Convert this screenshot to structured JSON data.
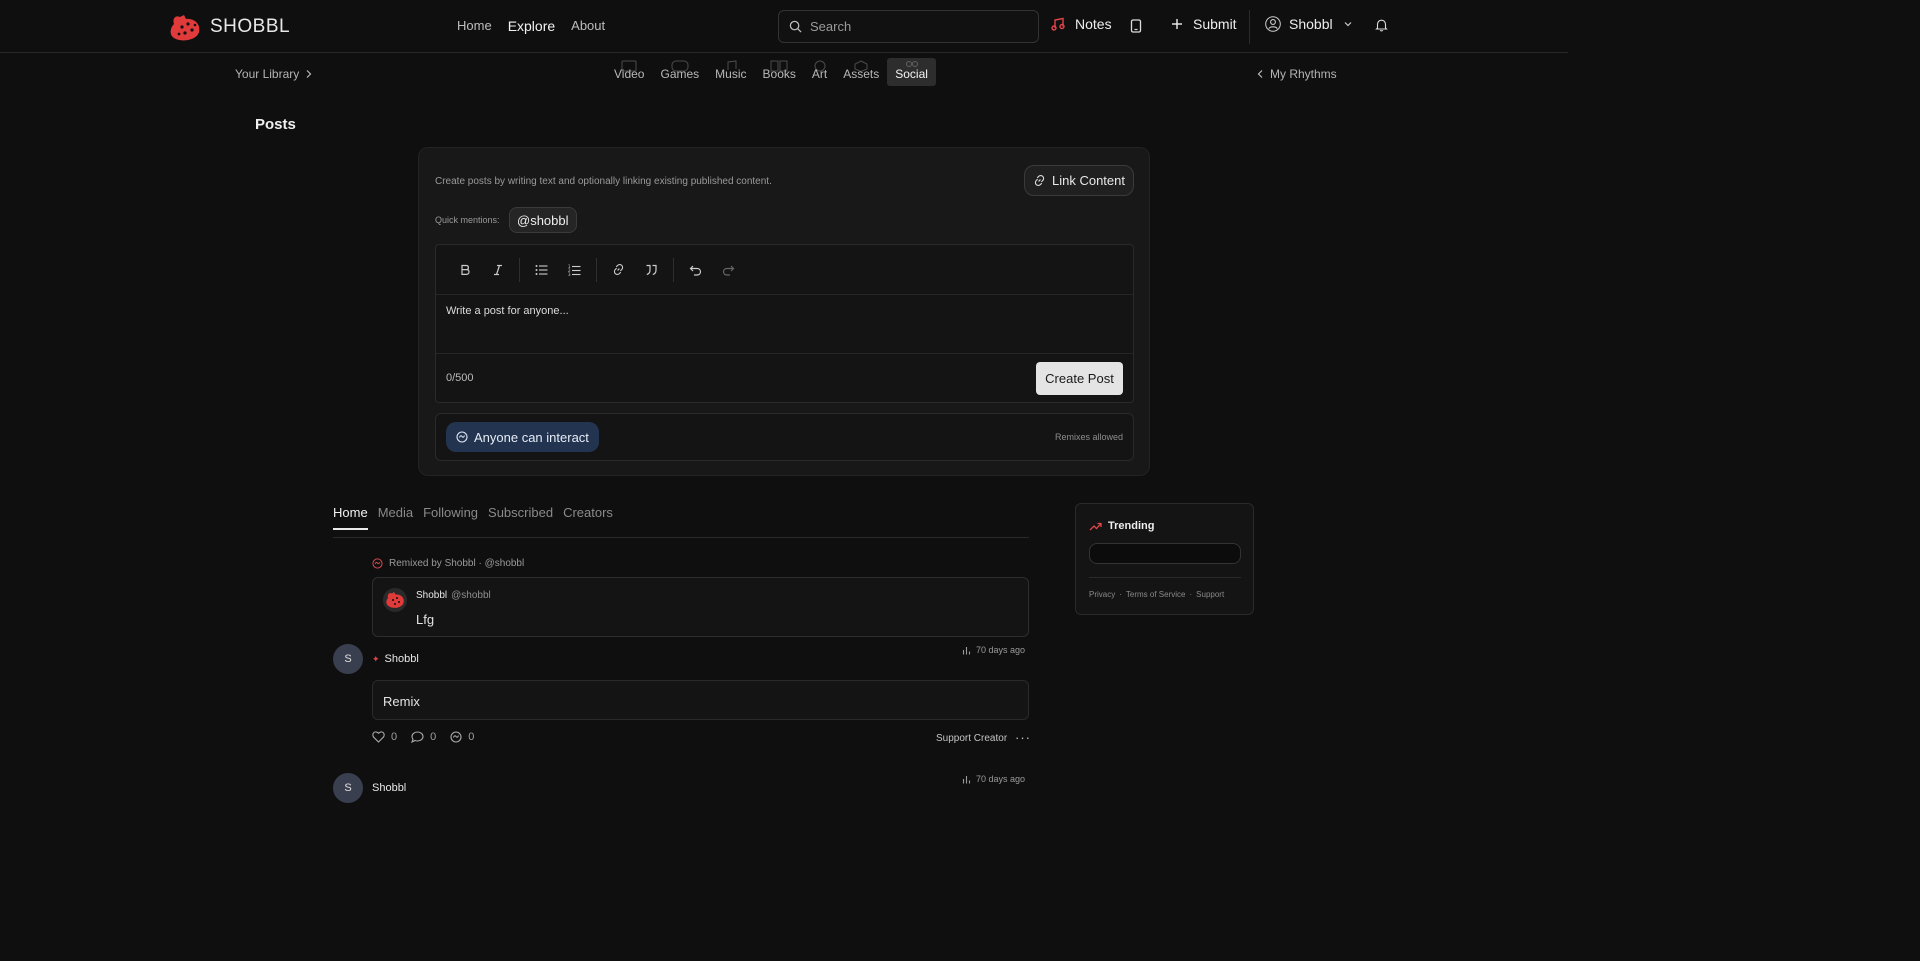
{
  "brand": {
    "name": "SHOBBL",
    "accent": "#e03a3a"
  },
  "nav": {
    "links": [
      {
        "label": "Home",
        "active": false
      },
      {
        "label": "Explore",
        "active": true
      },
      {
        "label": "About",
        "active": false
      }
    ],
    "search_placeholder": "Search",
    "notes_label": "Notes",
    "submit_label": "Submit",
    "user_label": "Shobbl"
  },
  "subnav": {
    "library_label": "Your Library",
    "rhythms_label": "My Rhythms",
    "categories": [
      {
        "label": "Video",
        "active": false
      },
      {
        "label": "Games",
        "active": false
      },
      {
        "label": "Music",
        "active": false
      },
      {
        "label": "Books",
        "active": false
      },
      {
        "label": "Art",
        "active": false
      },
      {
        "label": "Assets",
        "active": false
      },
      {
        "label": "Social",
        "active": true
      }
    ]
  },
  "page": {
    "title": "Posts"
  },
  "composer": {
    "helper_text": "Create posts by writing text and optionally linking existing published content.",
    "link_content_label": "Link Content",
    "mentions_label": "Quick mentions:",
    "mention_chip": "@shobbl",
    "placeholder": "Write a post for anyone...",
    "counter": "0/500",
    "create_label": "Create Post",
    "interact_label": "Anyone can interact",
    "remixes_label": "Remixes allowed"
  },
  "feed": {
    "tabs": [
      {
        "label": "Home",
        "active": true
      },
      {
        "label": "Media",
        "active": false
      },
      {
        "label": "Following",
        "active": false
      },
      {
        "label": "Subscribed",
        "active": false
      },
      {
        "label": "Creators",
        "active": false
      }
    ],
    "remixed_by": "Remixed by Shobbl · @shobbl",
    "quoted": {
      "name": "Shobbl",
      "handle": "@shobbl",
      "text": "Lfg"
    },
    "posts": [
      {
        "avatar": "S",
        "author": "Shobbl",
        "time": "70 days ago",
        "body": "Remix",
        "likes": "0",
        "comments": "0",
        "remixes": "0",
        "support_label": "Support Creator",
        "more": "···"
      },
      {
        "avatar": "S",
        "author": "Shobbl",
        "time": "70 days ago"
      }
    ]
  },
  "trending": {
    "title": "Trending",
    "footer": [
      "Privacy",
      "·",
      "Terms of Service",
      "·",
      "Support"
    ]
  }
}
